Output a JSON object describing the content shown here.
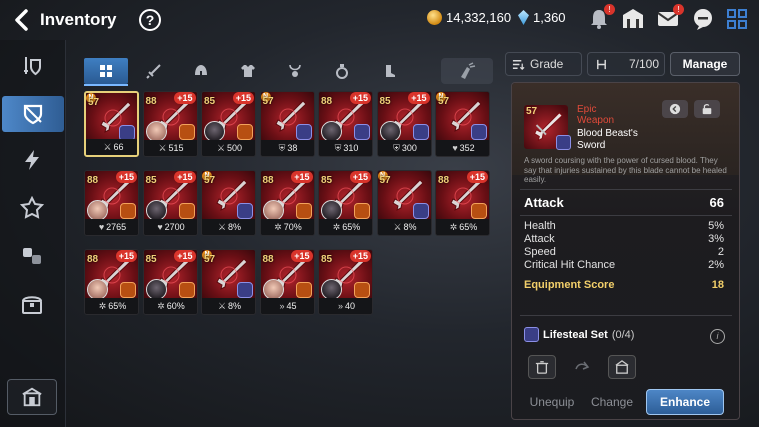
{
  "header": {
    "title": "Inventory",
    "help_glyph": "?",
    "gold": "14,332,160",
    "crystals": "1,360",
    "icons": [
      "bell-icon",
      "guild-icon",
      "mail-icon",
      "chat-icon",
      "menu-grid-icon"
    ],
    "notifications": {
      "bell": "!",
      "mail": "!"
    }
  },
  "sidebar": {
    "items": [
      "shield-sword-icon",
      "armor-shield-icon",
      "lightning-icon",
      "artifact-icon",
      "material-icon",
      "chest-icon"
    ],
    "active": "armor-shield-icon",
    "bottom": "storage-icon"
  },
  "tabs": [
    "all",
    "weapon",
    "helmet",
    "armor",
    "necklace",
    "ring",
    "boots"
  ],
  "filters": {
    "sort": "Grade",
    "capacity": "7/100",
    "manage": "Manage"
  },
  "items": [
    {
      "lvl": "57",
      "new": "N",
      "plus": "",
      "hero": false,
      "set": "blue",
      "stat_icon": "sword",
      "stat": "66",
      "selected": true
    },
    {
      "lvl": "88",
      "new": "",
      "plus": "+15",
      "hero": "light",
      "set": "orange",
      "stat_icon": "sword",
      "stat": "515"
    },
    {
      "lvl": "85",
      "new": "",
      "plus": "+15",
      "hero": "dark",
      "set": "orange",
      "stat_icon": "sword",
      "stat": "500"
    },
    {
      "lvl": "57",
      "new": "N",
      "plus": "",
      "hero": false,
      "set": "blue",
      "stat_icon": "shield",
      "stat": "38"
    },
    {
      "lvl": "88",
      "new": "",
      "plus": "+15",
      "hero": "dark",
      "set": "blue",
      "stat_icon": "shield",
      "stat": "310"
    },
    {
      "lvl": "85",
      "new": "",
      "plus": "+15",
      "hero": "dark",
      "set": "blue",
      "stat_icon": "shield",
      "stat": "300"
    },
    {
      "lvl": "57",
      "new": "N",
      "plus": "",
      "hero": false,
      "set": "blue",
      "stat_icon": "heart",
      "stat": "352"
    },
    {
      "lvl": "88",
      "new": "",
      "plus": "+15",
      "hero": "light",
      "set": "orange",
      "stat_icon": "heart",
      "stat": "2765"
    },
    {
      "lvl": "85",
      "new": "",
      "plus": "+15",
      "hero": "dark",
      "set": "orange",
      "stat_icon": "heart",
      "stat": "2700"
    },
    {
      "lvl": "57",
      "new": "N",
      "plus": "",
      "hero": false,
      "set": "blue",
      "stat_icon": "sword",
      "stat": "8%"
    },
    {
      "lvl": "88",
      "new": "",
      "plus": "+15",
      "hero": "light",
      "set": "orange",
      "stat_icon": "crit",
      "stat": "70%"
    },
    {
      "lvl": "85",
      "new": "",
      "plus": "+15",
      "hero": "dark",
      "set": "orange",
      "stat_icon": "crit",
      "stat": "65%"
    },
    {
      "lvl": "57",
      "new": "N",
      "plus": "",
      "hero": false,
      "set": "blue",
      "stat_icon": "sword",
      "stat": "8%"
    },
    {
      "lvl": "88",
      "new": "",
      "plus": "+15",
      "hero": false,
      "set": "orange",
      "stat_icon": "crit",
      "stat": "65%"
    },
    {
      "lvl": "88",
      "new": "",
      "plus": "+15",
      "hero": "light",
      "set": "orange",
      "stat_icon": "crit",
      "stat": "65%"
    },
    {
      "lvl": "85",
      "new": "",
      "plus": "+15",
      "hero": "dark",
      "set": "orange",
      "stat_icon": "crit",
      "stat": "60%"
    },
    {
      "lvl": "57",
      "new": "N",
      "plus": "",
      "hero": false,
      "set": "blue",
      "stat_icon": "sword",
      "stat": "8%"
    },
    {
      "lvl": "88",
      "new": "",
      "plus": "+15",
      "hero": "light",
      "set": "orange",
      "stat_icon": "speed",
      "stat": "45"
    },
    {
      "lvl": "85",
      "new": "",
      "plus": "+15",
      "hero": "dark",
      "set": "orange",
      "stat_icon": "speed",
      "stat": "40"
    }
  ],
  "detail": {
    "level": "57",
    "rarity": "Epic",
    "type": "Weapon",
    "name": "Blood Beast's Sword",
    "description": "A sword coursing with the power of cursed blood. They say that injuries sustained by this blade cannot be healed easily.",
    "main_stat": {
      "label": "Attack",
      "value": "66"
    },
    "substats": [
      {
        "label": "Health",
        "value": "5%"
      },
      {
        "label": "Attack",
        "value": "3%"
      },
      {
        "label": "Speed",
        "value": "2"
      },
      {
        "label": "Critical Hit Chance",
        "value": "2%"
      }
    ],
    "score": {
      "label": "Equipment Score",
      "value": "18"
    },
    "set": {
      "label": "Lifesteal Set",
      "count": "(0/4)"
    },
    "info_glyph": "i",
    "buttons": {
      "unequip": "Unequip",
      "change": "Change",
      "enhance": "Enhance"
    }
  },
  "colors": {
    "accent": "#3f7fc2",
    "gold_text": "#f2cf6a",
    "rarity_epic": "#e04a3a",
    "badge_red": "#d9342b"
  }
}
